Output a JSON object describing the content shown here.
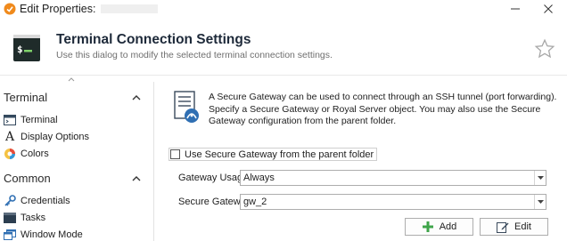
{
  "window": {
    "title": "Edit Properties:",
    "minimize_label": "—",
    "close_label": "✕"
  },
  "header": {
    "title": "Terminal Connection Settings",
    "subtitle": "Use this dialog to modify the selected terminal connection settings."
  },
  "sidebar": {
    "sections": [
      {
        "title": "Terminal",
        "items": [
          {
            "label": "Terminal",
            "icon": "terminal-icon"
          },
          {
            "label": "Display Options",
            "icon": "font-icon"
          },
          {
            "label": "Colors",
            "icon": "colors-icon"
          }
        ]
      },
      {
        "title": "Common",
        "items": [
          {
            "label": "Credentials",
            "icon": "key-icon"
          },
          {
            "label": "Tasks",
            "icon": "tasks-icon"
          },
          {
            "label": "Window Mode",
            "icon": "window-mode-icon"
          }
        ]
      }
    ]
  },
  "main": {
    "info_text": "A Secure Gateway can be used to connect through an SSH tunnel (port forwarding). Specify a Secure Gateway or Royal Server object. You may also use the Secure Gateway configuration from the parent folder.",
    "use_parent_checkbox": {
      "label": "Use Secure Gateway from the parent folder",
      "checked": false
    },
    "gateway_usage": {
      "label": "Gateway Usage:",
      "value": "Always"
    },
    "secure_gateway": {
      "label": "Secure Gateway:",
      "value": "gw_2"
    },
    "add_button": "Add",
    "edit_button": "Edit"
  },
  "colors": {
    "accent_orange": "#f08a1c",
    "add_green": "#3fa54a",
    "header_title": "#1e2a3a"
  }
}
